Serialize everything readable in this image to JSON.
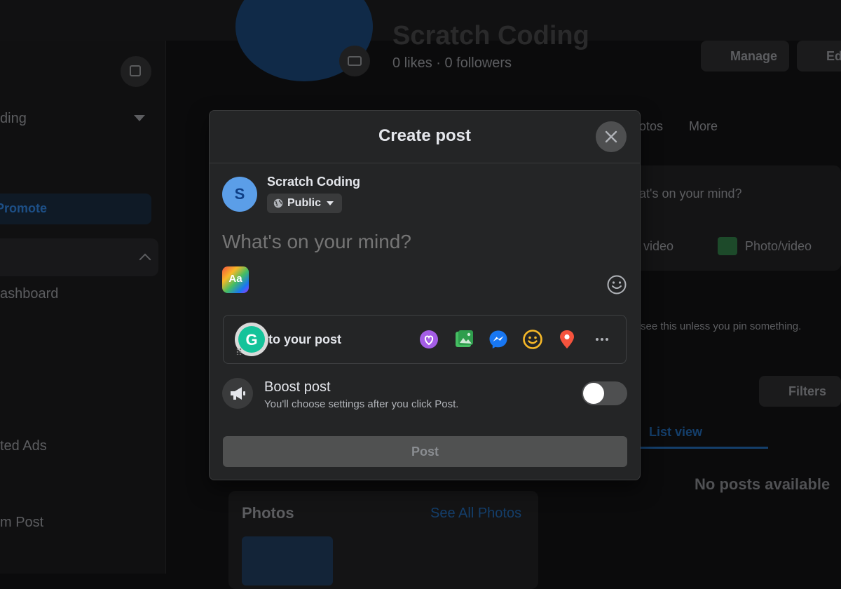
{
  "background": {
    "sidebar": {
      "item_partial_1": "ding",
      "promote_label": "Promote",
      "dashboard_label": "ashboard",
      "ads_label": "ted Ads",
      "post_label": "m Post"
    },
    "page": {
      "name": "Scratch Coding",
      "stats": "0 likes · 0 followers",
      "manage_label": "Manage",
      "edit_label": "Ed",
      "tab_photos_partial": "otos",
      "tab_more": "More",
      "composer_placeholder_partial": "at's on your mind?",
      "video_label_partial": "video",
      "photo_video_label": "Photo/video",
      "pinned_note_partial": "see this unless you pin something.",
      "filters_label": "Filters",
      "list_view_label": "List view",
      "no_posts": "No posts available",
      "photos_title": "Photos",
      "see_all_photos": "See All Photos"
    }
  },
  "modal": {
    "title": "Create post",
    "author": {
      "initial": "S",
      "name": "Scratch Coding",
      "privacy": "Public"
    },
    "composer": {
      "placeholder": "What's on your mind?",
      "bg_picker_label": "Aa"
    },
    "add_to_post": {
      "label": "to your post",
      "grammarly_letter": "G",
      "icons": [
        "feeling-icon",
        "photo-icon",
        "messenger-icon",
        "emoji-icon",
        "location-icon",
        "more-icon"
      ]
    },
    "boost": {
      "title": "Boost post",
      "subtitle": "You'll choose settings after you click Post.",
      "enabled": false
    },
    "post_button": "Post"
  },
  "colors": {
    "modal_bg": "#242526",
    "accent_blue": "#1877f2",
    "avatar_bg": "#5b9ee8",
    "disabled_button": "#505151"
  }
}
